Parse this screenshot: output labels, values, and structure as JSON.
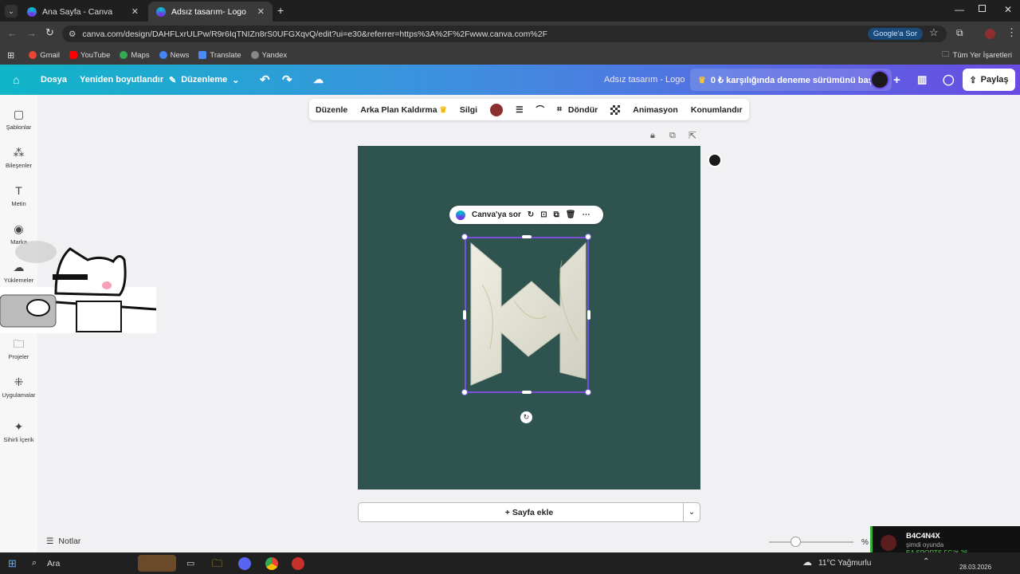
{
  "browser": {
    "tabs": [
      {
        "title": "Ana Sayfa - Canva",
        "active": false
      },
      {
        "title": "Adsız tasarım- Logo",
        "active": true
      }
    ],
    "url": "canva.com/design/DAHFLxrULPw/R9r6IqTNIZn8rS0UFGXqvQ/edit?ui=e30&referrer=https%3A%2F%2Fwww.canva.com%2F",
    "google_ask": "Google'a Sor",
    "bookmarks": [
      "Gmail",
      "YouTube",
      "Maps",
      "News",
      "Translate",
      "Yandex"
    ],
    "all_bookmarks": "Tüm Yer İşaretleri"
  },
  "header": {
    "file": "Dosya",
    "resize": "Yeniden boyutlandır",
    "editing": "Düzenleme",
    "title": "Adsız tasarım - Logo",
    "trial": "0 ₺ karşılığında deneme sürümünü başlat",
    "share": "Paylaş"
  },
  "sidebar": {
    "items": [
      "Şablonlar",
      "Bileşenler",
      "Metin",
      "Marka",
      "Yüklemeler",
      "Projeler",
      "Uygulamalar",
      "Sihirli İçerik"
    ]
  },
  "context_toolbar": {
    "edit": "Düzenle",
    "bg_remove": "Arka Plan Kaldırma",
    "eraser": "Silgi",
    "color": "#8b2f2f",
    "rotate": "Döndür",
    "animate": "Animasyon",
    "position": "Konumlandır"
  },
  "canvas": {
    "background": "#2f5450",
    "ask_canva": "Canva'ya sor"
  },
  "add_page": "+ Sayfa ekle",
  "notes": "Notlar",
  "zoom_label": "%",
  "notification": {
    "user": "B4C4N4X",
    "status": "şimdi oyunda",
    "game": "EA SPORTS FC™ 26"
  },
  "taskbar": {
    "search": "Ara",
    "weather": "11°C  Yağmurlu",
    "date": "28.03.2026"
  }
}
